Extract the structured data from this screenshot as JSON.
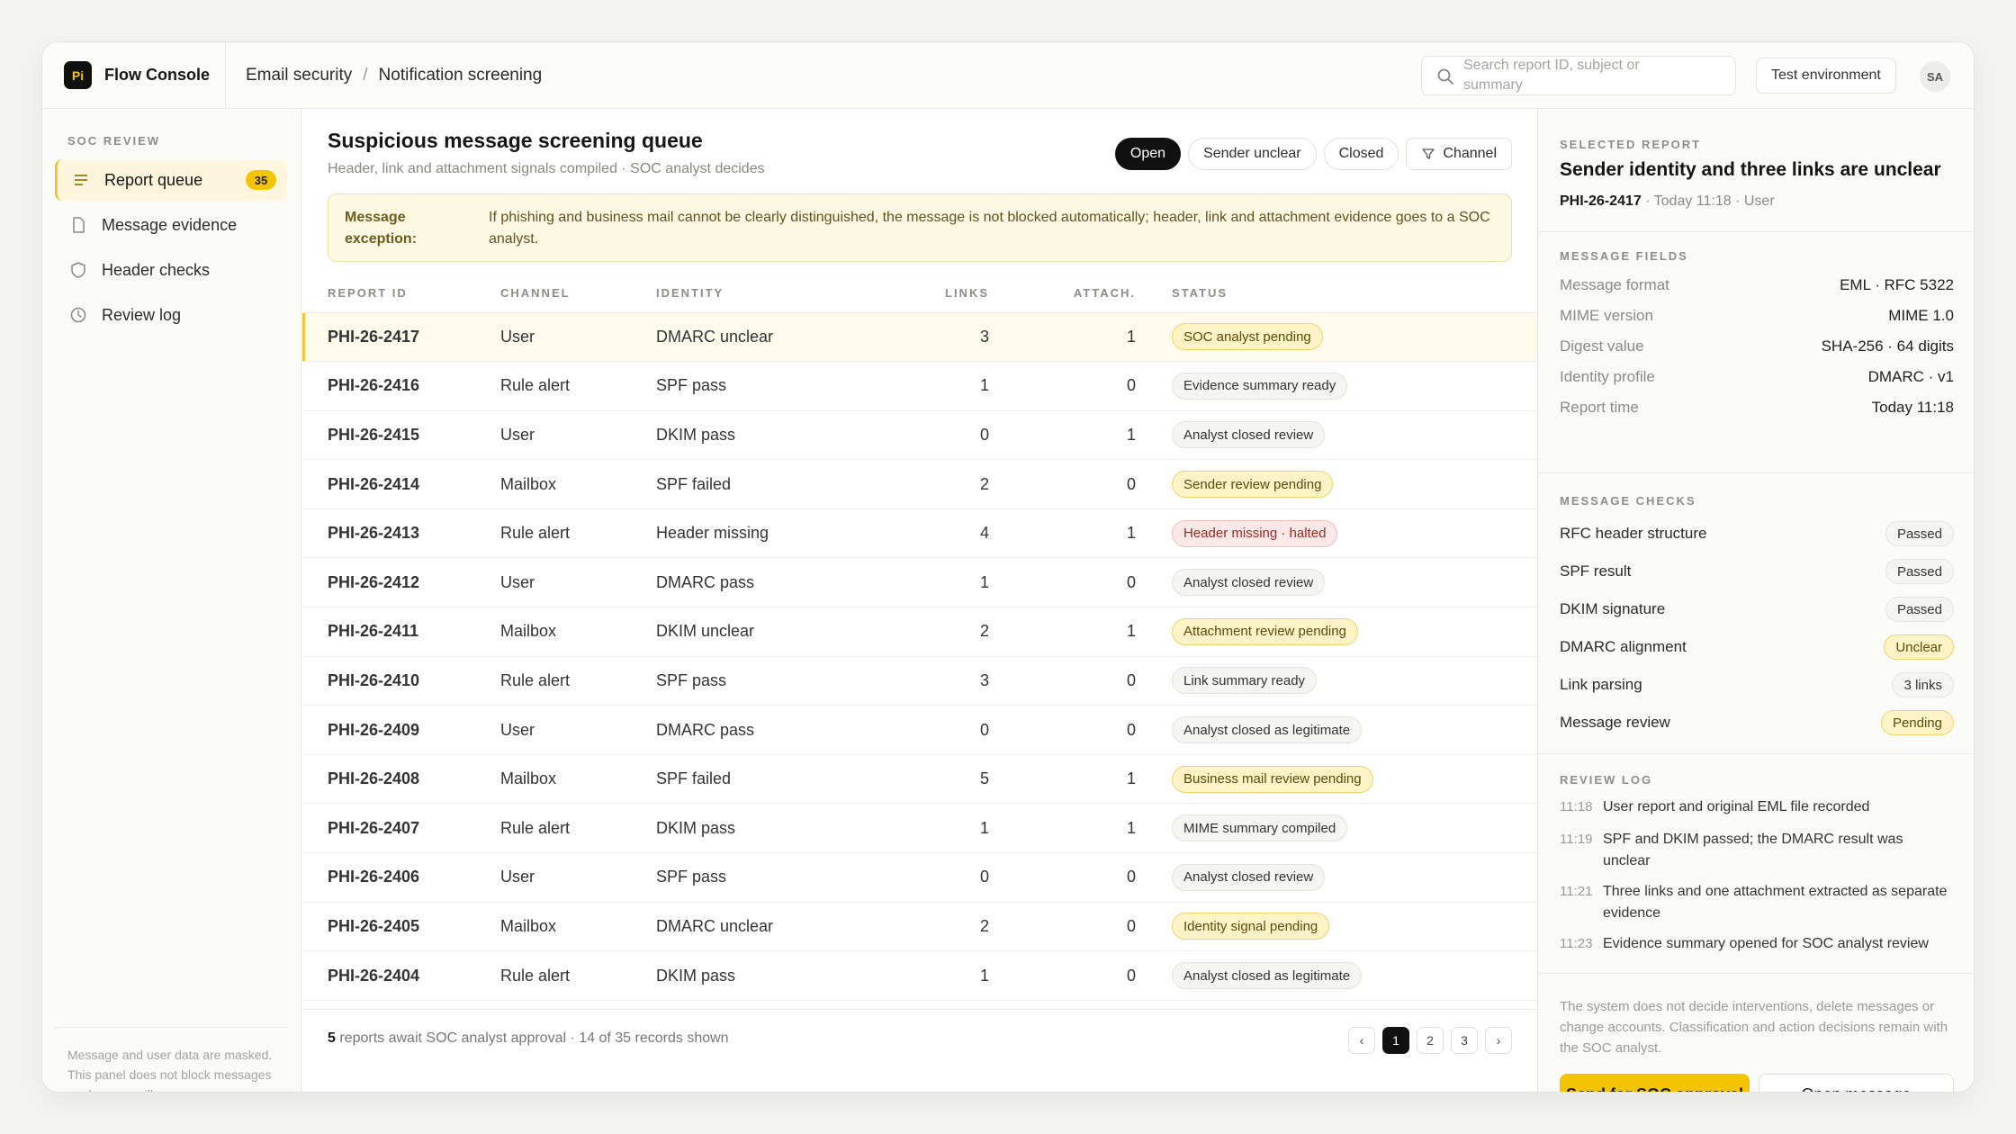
{
  "app": {
    "logo_text": "Pi",
    "name": "Flow Console"
  },
  "breadcrumb": [
    "Email security",
    "Notification screening"
  ],
  "search": {
    "placeholder": "Search report ID, subject or summary"
  },
  "header": {
    "environment": "Test environment",
    "avatar": "SA"
  },
  "sidebar": {
    "heading": "SOC REVIEW",
    "items": [
      {
        "label": "Report queue",
        "badge": "35",
        "icon": "list-icon"
      },
      {
        "label": "Message evidence",
        "icon": "file-icon"
      },
      {
        "label": "Header checks",
        "icon": "shield-icon"
      },
      {
        "label": "Review log",
        "icon": "clock-icon"
      }
    ],
    "note": "Message and user data are masked. This panel does not block messages or change mailboxes."
  },
  "main": {
    "title": "Suspicious message screening queue",
    "subtitle": "Header, link and attachment signals compiled · SOC analyst decides",
    "filters": [
      "Open",
      "Sender unclear",
      "Closed"
    ],
    "channel_filter": "Channel",
    "banner": {
      "label": "Message exception:",
      "text": "If phishing and business mail cannot be clearly distinguished, the message is not blocked automatically; header, link and attachment evidence goes to a SOC analyst."
    },
    "columns": [
      "REPORT ID",
      "CHANNEL",
      "IDENTITY",
      "LINKS",
      "ATTACH.",
      "STATUS"
    ],
    "rows": [
      {
        "id": "PHI-26-2417",
        "channel": "User",
        "identity": "DMARC unclear",
        "links": "3",
        "attach": "1",
        "status": "SOC analyst pending",
        "tone": "warn"
      },
      {
        "id": "PHI-26-2416",
        "channel": "Rule alert",
        "identity": "SPF pass",
        "links": "1",
        "attach": "0",
        "status": "Evidence summary ready",
        "tone": "neutral"
      },
      {
        "id": "PHI-26-2415",
        "channel": "User",
        "identity": "DKIM pass",
        "links": "0",
        "attach": "1",
        "status": "Analyst closed review",
        "tone": "neutral"
      },
      {
        "id": "PHI-26-2414",
        "channel": "Mailbox",
        "identity": "SPF failed",
        "links": "2",
        "attach": "0",
        "status": "Sender review pending",
        "tone": "warn"
      },
      {
        "id": "PHI-26-2413",
        "channel": "Rule alert",
        "identity": "Header missing",
        "links": "4",
        "attach": "1",
        "status": "Header missing · halted",
        "tone": "bad"
      },
      {
        "id": "PHI-26-2412",
        "channel": "User",
        "identity": "DMARC pass",
        "links": "1",
        "attach": "0",
        "status": "Analyst closed review",
        "tone": "neutral"
      },
      {
        "id": "PHI-26-2411",
        "channel": "Mailbox",
        "identity": "DKIM unclear",
        "links": "2",
        "attach": "1",
        "status": "Attachment review pending",
        "tone": "warn"
      },
      {
        "id": "PHI-26-2410",
        "channel": "Rule alert",
        "identity": "SPF pass",
        "links": "3",
        "attach": "0",
        "status": "Link summary ready",
        "tone": "neutral"
      },
      {
        "id": "PHI-26-2409",
        "channel": "User",
        "identity": "DMARC pass",
        "links": "0",
        "attach": "0",
        "status": "Analyst closed as legitimate",
        "tone": "neutral"
      },
      {
        "id": "PHI-26-2408",
        "channel": "Mailbox",
        "identity": "SPF failed",
        "links": "5",
        "attach": "1",
        "status": "Business mail review pending",
        "tone": "warn"
      },
      {
        "id": "PHI-26-2407",
        "channel": "Rule alert",
        "identity": "DKIM pass",
        "links": "1",
        "attach": "1",
        "status": "MIME summary compiled",
        "tone": "neutral"
      },
      {
        "id": "PHI-26-2406",
        "channel": "User",
        "identity": "SPF pass",
        "links": "0",
        "attach": "0",
        "status": "Analyst closed review",
        "tone": "neutral"
      },
      {
        "id": "PHI-26-2405",
        "channel": "Mailbox",
        "identity": "DMARC unclear",
        "links": "2",
        "attach": "0",
        "status": "Identity signal pending",
        "tone": "warn"
      },
      {
        "id": "PHI-26-2404",
        "channel": "Rule alert",
        "identity": "DKIM pass",
        "links": "1",
        "attach": "0",
        "status": "Analyst closed as legitimate",
        "tone": "neutral"
      }
    ],
    "footer": {
      "count": "5",
      "text": " reports await SOC analyst approval · 14 of 35 records shown"
    },
    "pager": {
      "prev": "‹",
      "pages": [
        "1",
        "2",
        "3"
      ],
      "next": "›"
    }
  },
  "panel": {
    "selected_heading": "SELECTED REPORT",
    "title": "Sender identity and three links are unclear",
    "report_id": "PHI-26-2417",
    "meta": " · Today 11:18 · User",
    "fields_heading": "MESSAGE FIELDS",
    "fields": [
      {
        "key": "Message format",
        "value": "EML · RFC 5322"
      },
      {
        "key": "MIME version",
        "value": "MIME 1.0"
      },
      {
        "key": "Digest value",
        "value": "SHA-256 · 64 digits"
      },
      {
        "key": "Identity profile",
        "value": "DMARC · v1"
      },
      {
        "key": "Report time",
        "value": "Today 11:18"
      }
    ],
    "checks_heading": "MESSAGE CHECKS",
    "checks": [
      {
        "label": "RFC header structure",
        "value": "Passed",
        "tone": "neutral"
      },
      {
        "label": "SPF result",
        "value": "Passed",
        "tone": "neutral"
      },
      {
        "label": "DKIM signature",
        "value": "Passed",
        "tone": "neutral"
      },
      {
        "label": "DMARC alignment",
        "value": "Unclear",
        "tone": "warn"
      },
      {
        "label": "Link parsing",
        "value": "3 links",
        "tone": "neutral"
      },
      {
        "label": "Message review",
        "value": "Pending",
        "tone": "warn"
      }
    ],
    "log_heading": "REVIEW LOG",
    "log": [
      {
        "time": "11:18",
        "text": "User report and original EML file recorded"
      },
      {
        "time": "11:19",
        "text": "SPF and DKIM passed; the DMARC result was unclear"
      },
      {
        "time": "11:21",
        "text": "Three links and one attachment extracted as separate evidence"
      },
      {
        "time": "11:23",
        "text": "Evidence summary opened for SOC analyst review"
      }
    ],
    "note": "The system does not decide interventions, delete messages or change accounts. Classification and action decisions remain with the SOC analyst.",
    "primary_button": "Send for SOC approval",
    "secondary_button": "Open message"
  }
}
